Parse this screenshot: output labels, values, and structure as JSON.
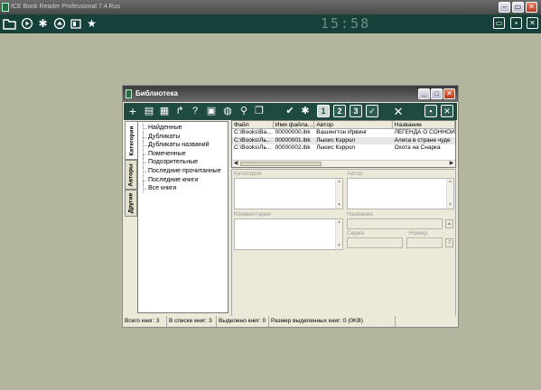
{
  "app": {
    "title": "ICE Book Reader Professional 7.4 Rus",
    "clock": "15:58",
    "toolbar_icons": [
      "folder-icon",
      "play-icon",
      "settings-icon",
      "sync-icon",
      "library-icon",
      "star-icon"
    ],
    "window_buttons": {
      "restore": "▭",
      "minimize": "–",
      "close": "✕"
    }
  },
  "library": {
    "title": "Библиотека",
    "window_buttons": {
      "minimize": "_",
      "maximize": "□",
      "close": "✕"
    },
    "toolbar_icons": [
      "add-icon",
      "folder-add-icon",
      "notes-icon",
      "redo-icon",
      "help-icon",
      "save-icon",
      "globe-icon",
      "search-icon",
      "copy-icon",
      "check-icon",
      "settings-icon",
      "close-icon"
    ],
    "number_buttons": [
      "1",
      "2",
      "3"
    ],
    "vertical_tabs": [
      "Категории",
      "Авторы",
      "Другие"
    ],
    "tree_items": [
      "Найденные",
      "Дубликаты",
      "Дубликаты названий",
      "Помеченные",
      "Подозрительные",
      "Последние прочитанные",
      "Последние книги",
      "Все книги"
    ],
    "table": {
      "headers": [
        "Файл",
        "Имя файла...",
        "Автор",
        "Название"
      ],
      "rows": [
        [
          "C:\\Books\\Ва...",
          "00000000.ibk",
          "Вашингтон Ирвинг",
          "ЛЕГЕНДА О СОННОЙ"
        ],
        [
          "C:\\Books\\Ль...",
          "00000001.ibk",
          "Льюис Кэррол",
          "Алиса в стране чуде"
        ],
        [
          "C:\\Books\\Ль...",
          "00000002.ibk",
          "Льюис Кэррол",
          "Охота на Снарка"
        ]
      ]
    },
    "fields": {
      "category": "Категория",
      "author": "Автор",
      "comments": "Комментарии",
      "title": "Название",
      "series": "Серия",
      "number": "Номер"
    },
    "status": {
      "total": "Всего книг: 3",
      "in_list": "В списке книг: 3",
      "selected": "Выделено книг: 0",
      "selected_size": "Размер выделенных книг: 0  (0KB)"
    }
  },
  "colors": {
    "desktop": "#b3b59f",
    "toolbar": "#16403a",
    "lib_toolbar": "#1e4a40"
  }
}
